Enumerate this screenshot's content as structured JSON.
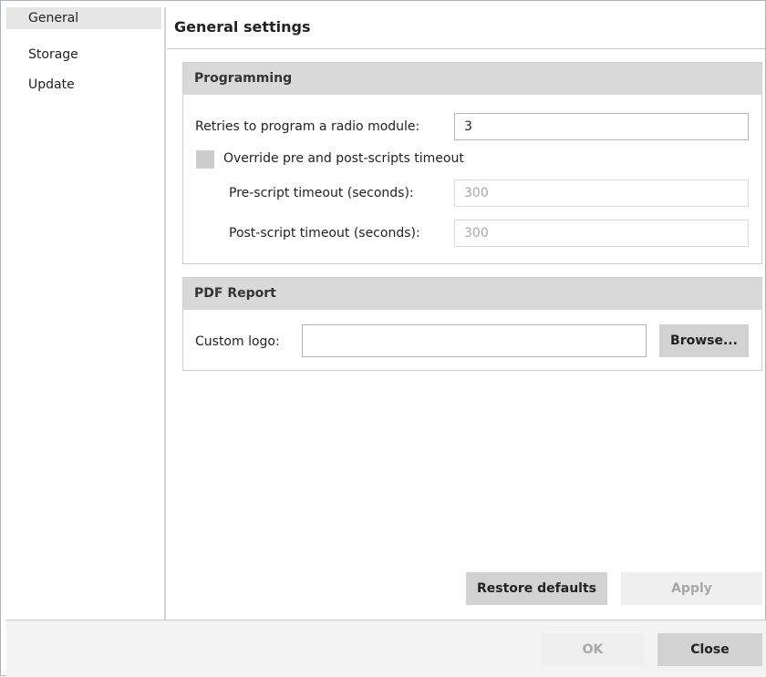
{
  "sidebar": {
    "items": [
      {
        "label": "General",
        "selected": true
      },
      {
        "label": "Storage",
        "selected": false
      },
      {
        "label": "Update",
        "selected": false
      }
    ]
  },
  "main": {
    "title": "General settings",
    "programming": {
      "header": "Programming",
      "retries_label": "Retries to program a radio module:",
      "retries_value": "3",
      "override_label": "Override pre and post-scripts timeout",
      "override_checked": false,
      "pre_label": "Pre-script timeout (seconds):",
      "pre_value": "300",
      "post_label": "Post-script timeout (seconds):",
      "post_value": "300"
    },
    "pdf_report": {
      "header": "PDF Report",
      "logo_label": "Custom logo:",
      "logo_value": "",
      "browse_label": "Browse..."
    },
    "restore_label": "Restore defaults",
    "apply_label": "Apply"
  },
  "footer": {
    "ok_label": "OK",
    "close_label": "Close"
  },
  "colors": {
    "group_header_bg": "#d9d9d9",
    "selected_item_bg": "#e6e6e6",
    "button_bg": "#d2d2d2",
    "disabled_button_bg": "#efefef"
  }
}
